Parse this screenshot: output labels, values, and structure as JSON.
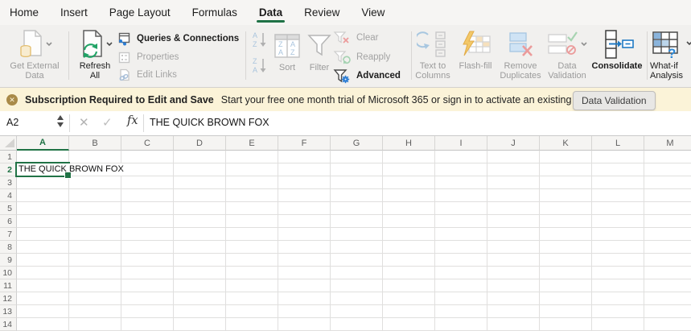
{
  "menu_bar": {
    "tabs": [
      {
        "label": "Home"
      },
      {
        "label": "Insert"
      },
      {
        "label": "Page Layout"
      },
      {
        "label": "Formulas"
      },
      {
        "label": "Data",
        "active": true
      },
      {
        "label": "Review"
      },
      {
        "label": "View"
      }
    ]
  },
  "ribbon": {
    "get_external_data": {
      "label": "Get External Data",
      "enabled": false
    },
    "refresh_all": {
      "label": "Refresh All",
      "enabled": true
    },
    "queries_connections": {
      "label": "Queries & Connections",
      "enabled": true
    },
    "properties": {
      "label": "Properties",
      "enabled": false
    },
    "edit_links": {
      "label": "Edit Links",
      "enabled": false
    },
    "sort": {
      "label": "Sort",
      "enabled": false
    },
    "filter": {
      "label": "Filter",
      "enabled": false
    },
    "clear": {
      "label": "Clear",
      "enabled": false
    },
    "reapply": {
      "label": "Reapply",
      "enabled": false
    },
    "advanced": {
      "label": "Advanced",
      "enabled": true
    },
    "text_to_columns": {
      "label": "Text to Columns",
      "enabled": false
    },
    "flash_fill": {
      "label": "Flash-fill",
      "enabled": false
    },
    "remove_duplicates": {
      "label": "Remove Duplicates",
      "enabled": false
    },
    "data_validation": {
      "label": "Data Validation",
      "enabled": false
    },
    "consolidate": {
      "label": "Consolidate",
      "enabled": true
    },
    "what_if_analysis": {
      "label": "What-if Analysis",
      "enabled": true
    }
  },
  "notification_bar": {
    "icon": "error-circle-icon",
    "title": "Subscription Required to Edit and Save",
    "message": "Start your free one month trial of Microsoft 365 or sign in to activate an existing"
  },
  "tooltip": {
    "label": "Data Validation"
  },
  "formula_bar": {
    "name_box": "A2",
    "cancel_glyph": "✕",
    "enter_glyph": "✓",
    "fx_label": "fx",
    "value": "THE QUICK BROWN FOX"
  },
  "grid": {
    "columns": [
      "A",
      "B",
      "C",
      "D",
      "E",
      "F",
      "G",
      "H",
      "I",
      "J",
      "K",
      "L",
      "M"
    ],
    "rows": [
      "1",
      "2",
      "3",
      "4",
      "5",
      "6",
      "7",
      "8",
      "9",
      "10",
      "11",
      "12",
      "13",
      "14"
    ],
    "selected_column": "A",
    "selected_row": "2",
    "active_cell": {
      "ref": "A2",
      "value": "THE QUICK BROWN FOX"
    }
  },
  "colors": {
    "accent_green": "#217346",
    "banner_bg": "#fbf3d8",
    "banner_icon": "#a98a48",
    "icon_blue": "#2b7cd3"
  }
}
